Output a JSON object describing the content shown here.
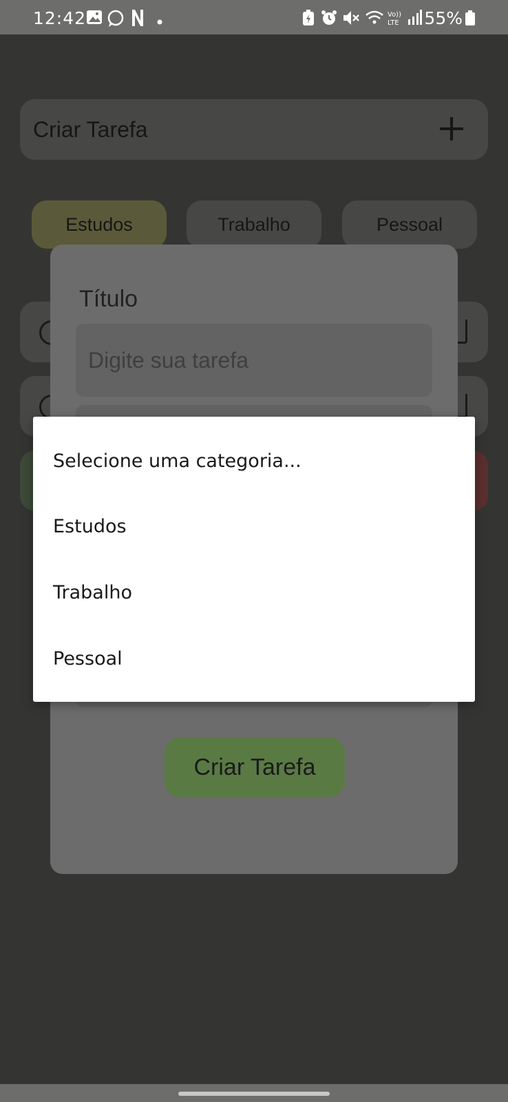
{
  "status_bar": {
    "time": "12:42",
    "battery": "55%",
    "icons": [
      "gallery-icon",
      "whatsapp-icon",
      "netflix-icon",
      "dot-icon",
      "battery-saver-icon",
      "alarm-icon",
      "mute-icon",
      "wifi-icon",
      "volte-icon",
      "signal-icon",
      "battery-icon"
    ]
  },
  "header": {
    "create_label": "Criar Tarefa"
  },
  "categories": {
    "items": [
      {
        "label": "Estudos"
      },
      {
        "label": "Trabalho"
      },
      {
        "label": "Pessoal"
      }
    ],
    "active_color": "#5a5a3a"
  },
  "modal": {
    "title_label": "Título",
    "title_placeholder": "Digite sua tarefa",
    "submit_label": "Criar Tarefa",
    "submit_color": "#5a7a44"
  },
  "dropdown": {
    "options": [
      {
        "label": "Selecione uma categoria..."
      },
      {
        "label": "Estudos"
      },
      {
        "label": "Trabalho"
      },
      {
        "label": "Pessoal"
      }
    ]
  }
}
